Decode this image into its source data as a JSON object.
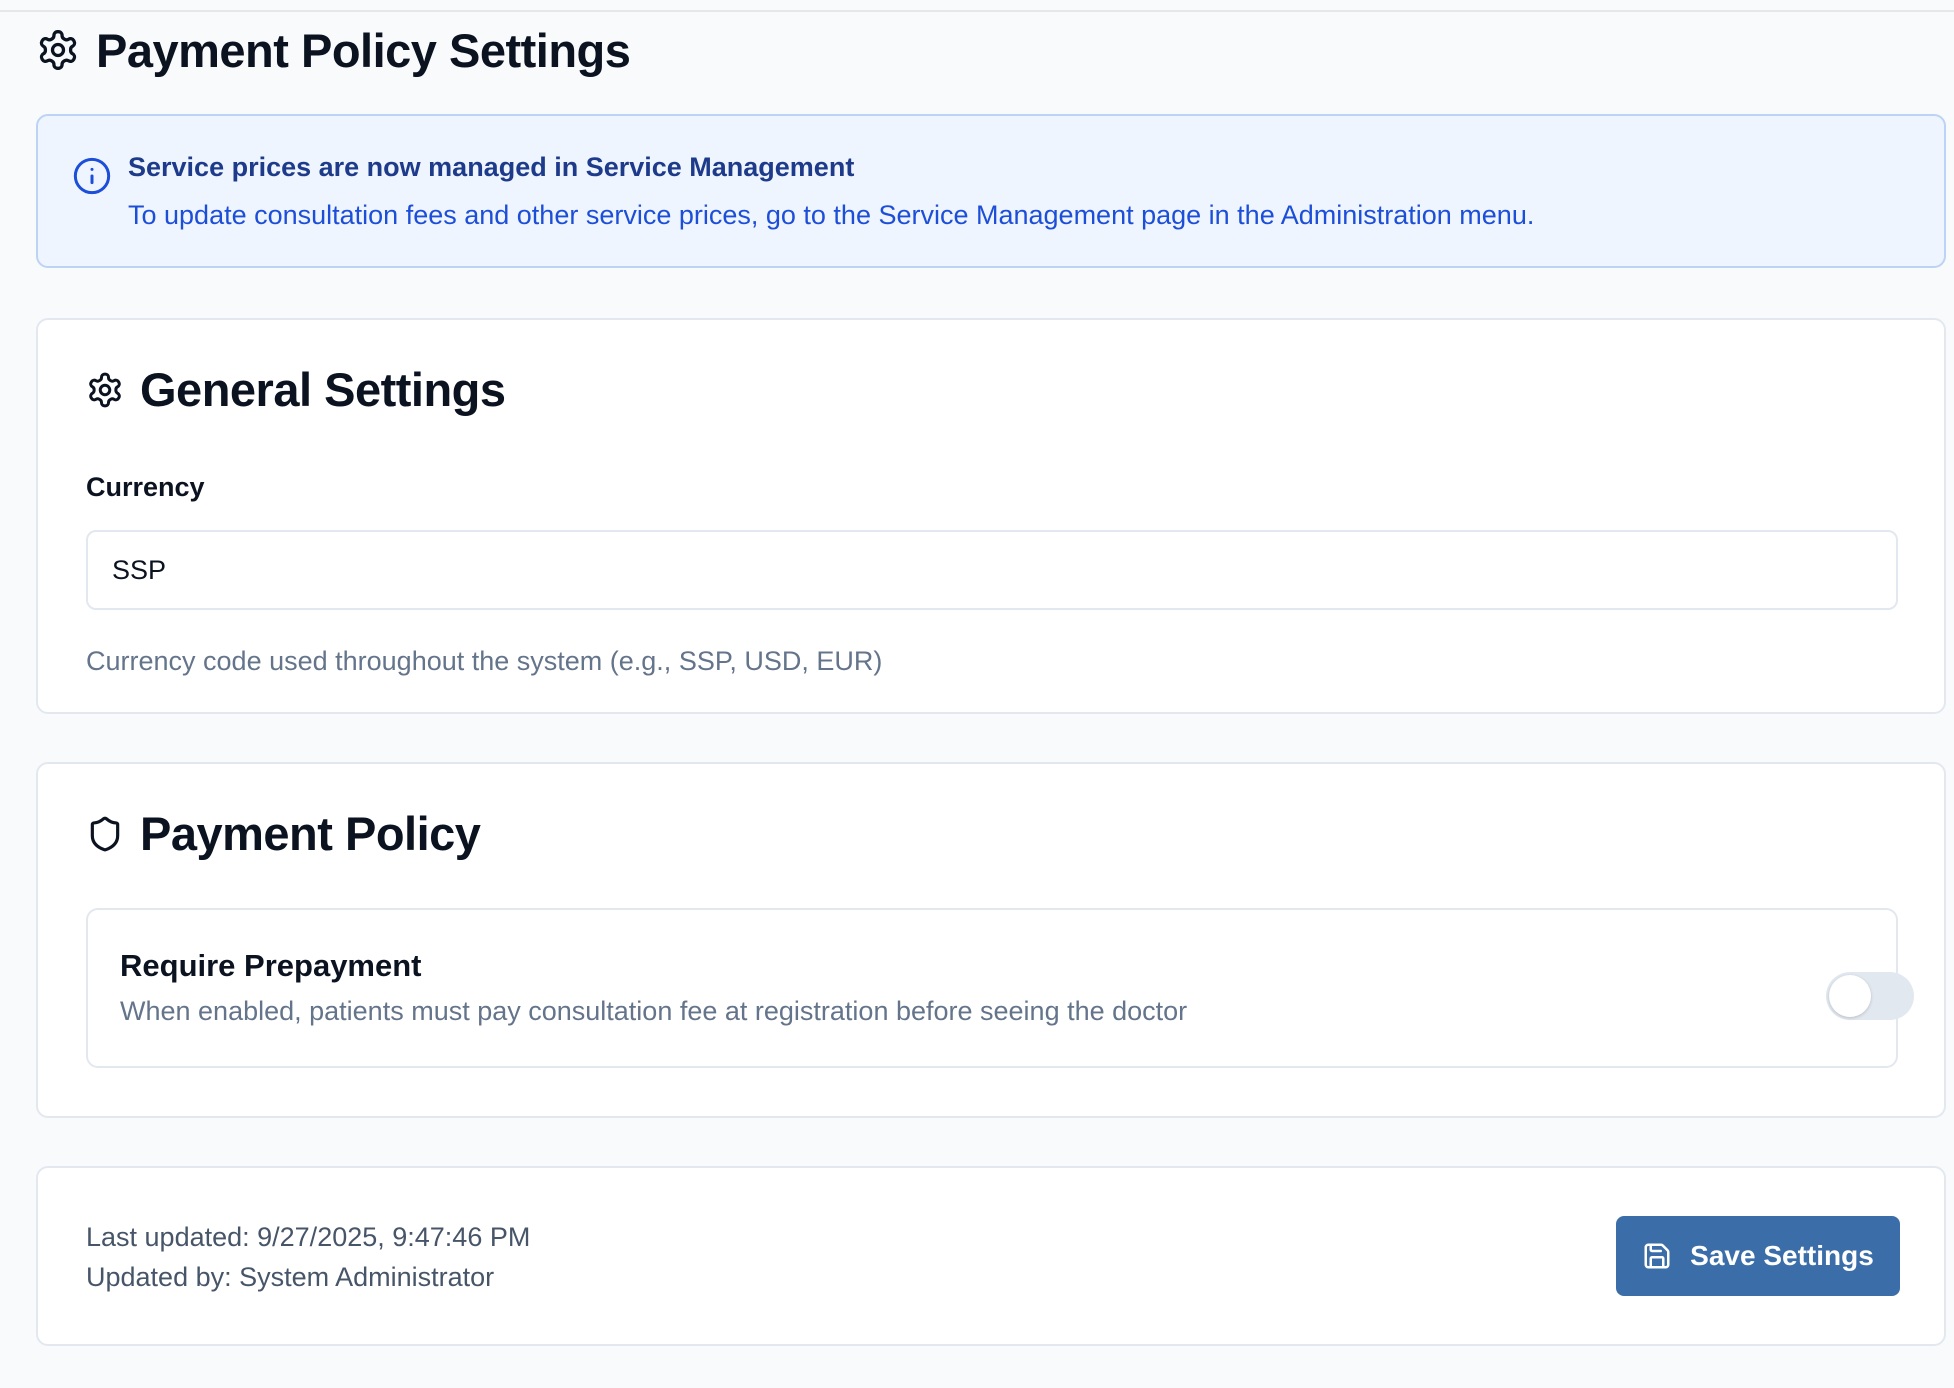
{
  "page": {
    "title": "Payment Policy Settings",
    "title_icon": "gear-icon"
  },
  "info_banner": {
    "icon": "info-icon",
    "title": "Service prices are now managed in Service Management",
    "text": "To update consultation fees and other service prices, go to the Service Management page in the Administration menu."
  },
  "general_settings": {
    "icon": "gear-icon",
    "title": "General Settings",
    "currency_label": "Currency",
    "currency_value": "SSP",
    "currency_help": "Currency code used throughout the system (e.g., SSP, USD, EUR)"
  },
  "payment_policy": {
    "icon": "shield-icon",
    "title": "Payment Policy",
    "require_prepayment": {
      "label": "Require Prepayment",
      "description": "When enabled, patients must pay consultation fee at registration before seeing the doctor",
      "enabled": false
    }
  },
  "footer": {
    "last_updated": "Last updated: 9/27/2025, 9:47:46 PM",
    "updated_by": "Updated by: System Administrator",
    "save_label": "Save Settings",
    "save_icon": "save-icon"
  },
  "colors": {
    "primary_button": "#3b6ea8",
    "info_background": "#eef5fe",
    "info_text": "#1d4ed8",
    "toggle_off": "#e2e8f0"
  }
}
